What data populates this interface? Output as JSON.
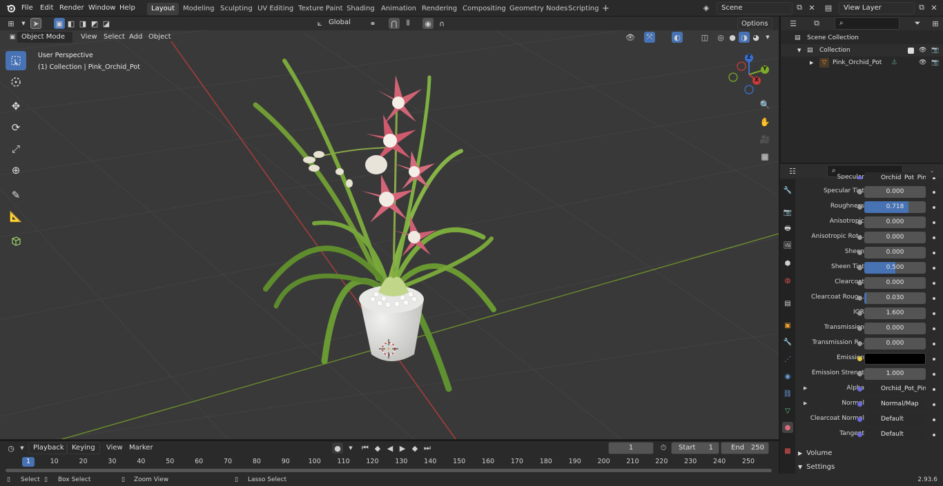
{
  "topbar": {
    "menus": [
      "File",
      "Edit",
      "Render",
      "Window",
      "Help"
    ],
    "workspaces": [
      "Layout",
      "Modeling",
      "Sculpting",
      "UV Editing",
      "Texture Paint",
      "Shading",
      "Animation",
      "Rendering",
      "Compositing",
      "Geometry Nodes",
      "Scripting"
    ],
    "active_workspace": "Layout",
    "add_tab": "+",
    "scene": "Scene",
    "view_layer": "View Layer"
  },
  "header": {
    "mode": "Object Mode",
    "menus": [
      "View",
      "Select",
      "Add",
      "Object"
    ],
    "transform_orientation": "Global",
    "options": "Options"
  },
  "viewport": {
    "perspective": "User Perspective",
    "collection_info": "(1) Collection | Pink_Orchid_Pot",
    "gizmo": {
      "x": "X",
      "y": "Y",
      "z": "Z"
    }
  },
  "outliner": {
    "scene_collection": "Scene Collection",
    "collection": "Collection",
    "object": "Pink_Orchid_Pot"
  },
  "properties": {
    "rows": [
      {
        "label": "Specular",
        "value": "Orchid_Pot_Pink_Bu...",
        "type": "link",
        "partial": true
      },
      {
        "label": "Specular Tint",
        "value": "0.000"
      },
      {
        "label": "Roughness",
        "value": "0.718",
        "fill": 0.718
      },
      {
        "label": "Anisotropic",
        "value": "0.000"
      },
      {
        "label": "Anisotropic Rot...",
        "value": "0.000"
      },
      {
        "label": "Sheen",
        "value": "0.000"
      },
      {
        "label": "Sheen Tint",
        "value": "0.500",
        "fill": 0.5
      },
      {
        "label": "Clearcoat",
        "value": "0.000"
      },
      {
        "label": "Clearcoat Roug...",
        "value": "0.030",
        "fill": 0.03
      },
      {
        "label": "IOR",
        "value": "1.600"
      },
      {
        "label": "Transmission",
        "value": "0.000"
      },
      {
        "label": "Transmission R...",
        "value": "0.000"
      },
      {
        "label": "Emission",
        "value": "",
        "type": "color",
        "color": "#000000"
      },
      {
        "label": "Emission Strengt",
        "value": "1.000"
      },
      {
        "label": "Alpha",
        "value": "Orchid_Pot_Pink_Bu...",
        "type": "link",
        "expand": true
      },
      {
        "label": "Normal",
        "value": "Normal/Map",
        "type": "link",
        "expand": true
      },
      {
        "label": "Clearcoat Normal",
        "value": "Default",
        "type": "link"
      },
      {
        "label": "Tangent",
        "value": "Default",
        "type": "link"
      }
    ],
    "panels": [
      "Volume",
      "Settings"
    ]
  },
  "timeline": {
    "menus": [
      "Playback",
      "Keying",
      "View",
      "Marker"
    ],
    "current_frame": "1",
    "start_label": "Start",
    "start": "1",
    "end_label": "End",
    "end": "250",
    "ticks": [
      "1",
      "10",
      "20",
      "30",
      "40",
      "50",
      "60",
      "70",
      "80",
      "90",
      "100",
      "110",
      "120",
      "130",
      "140",
      "150",
      "160",
      "170",
      "180",
      "190",
      "200",
      "210",
      "220",
      "230",
      "240",
      "250"
    ]
  },
  "statusbar": {
    "select": "Select",
    "box_select": "Box Select",
    "zoom_view": "Zoom View",
    "lasso_select": "Lasso Select",
    "version": "2.93.6"
  },
  "colors": {
    "accent": "#4772b3",
    "x_axis": "#c73a3a",
    "y_axis": "#7da82a",
    "z_axis": "#3a6fd0"
  }
}
